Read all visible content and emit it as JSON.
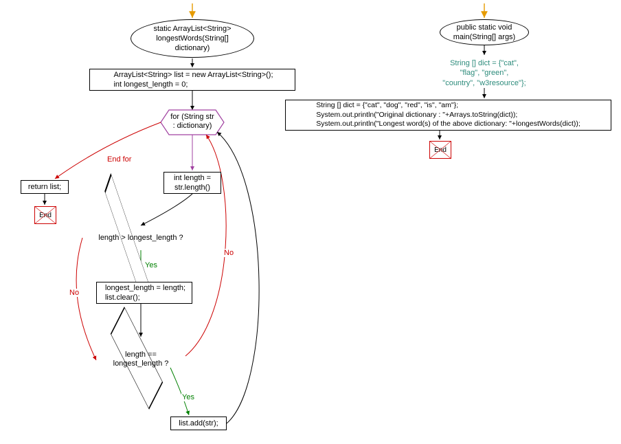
{
  "left": {
    "start": "static ArrayList<String>\nlongestWords(String[]\ndictionary)",
    "init": "ArrayList<String> list = new ArrayList<String>();\nint longest_length = 0;",
    "loop": "for (String str\n: dictionary)",
    "endfor_label": "End for",
    "return": "return list;",
    "end": "End",
    "lenAssign": "int length =\nstr.length()",
    "cond1": "length > longest_length ?",
    "yes": "Yes",
    "no": "No",
    "clear": "longest_length = length;\nlist.clear();",
    "cond2": "length ==\nlongest_length ?",
    "add": "list.add(str);"
  },
  "right": {
    "start": "public static void\nmain(String[] args)",
    "dictComment": "String [] dict = {\"cat\",\n\"flag\", \"green\",\n\"country\", \"w3resource\"};",
    "block": "String [] dict = {\"cat\", \"dog\", \"red\", \"is\", \"am\"};\nSystem.out.println(\"Original dictionary : \"+Arrays.toString(dict));\nSystem.out.println(\"Longest word(s) of the above dictionary: \"+longestWords(dict));",
    "end": "End"
  },
  "chart_data": {
    "type": "flowchart",
    "subgraphs": [
      {
        "name": "longestWords",
        "nodes": [
          {
            "id": "l_entry",
            "kind": "entry_arrow"
          },
          {
            "id": "l_start",
            "kind": "terminator",
            "text": "static ArrayList<String> longestWords(String[] dictionary)"
          },
          {
            "id": "l_init",
            "kind": "process",
            "text": "ArrayList<String> list = new ArrayList<String>(); int longest_length = 0;"
          },
          {
            "id": "l_loop",
            "kind": "loop_hex",
            "text": "for (String str : dictionary)"
          },
          {
            "id": "l_return",
            "kind": "process",
            "text": "return list;"
          },
          {
            "id": "l_end",
            "kind": "end"
          },
          {
            "id": "l_len",
            "kind": "process",
            "text": "int length = str.length()"
          },
          {
            "id": "l_cond1",
            "kind": "decision",
            "text": "length > longest_length ?"
          },
          {
            "id": "l_clear",
            "kind": "process",
            "text": "longest_length = length; list.clear();"
          },
          {
            "id": "l_cond2",
            "kind": "decision",
            "text": "length == longest_length ?"
          },
          {
            "id": "l_add",
            "kind": "process",
            "text": "list.add(str);"
          }
        ],
        "edges": [
          {
            "from": "l_entry",
            "to": "l_start",
            "color": "orange"
          },
          {
            "from": "l_start",
            "to": "l_init"
          },
          {
            "from": "l_init",
            "to": "l_loop"
          },
          {
            "from": "l_loop",
            "to": "l_return",
            "label": "End for",
            "color": "red"
          },
          {
            "from": "l_return",
            "to": "l_end"
          },
          {
            "from": "l_loop",
            "to": "l_len",
            "color": "purple"
          },
          {
            "from": "l_len",
            "to": "l_cond1"
          },
          {
            "from": "l_cond1",
            "to": "l_clear",
            "label": "Yes",
            "color": "green"
          },
          {
            "from": "l_cond1",
            "to": "l_cond2",
            "label": "No",
            "color": "red"
          },
          {
            "from": "l_clear",
            "to": "l_cond2"
          },
          {
            "from": "l_cond2",
            "to": "l_add",
            "label": "Yes",
            "color": "green"
          },
          {
            "from": "l_cond2",
            "to": "l_loop",
            "label": "No",
            "color": "red"
          },
          {
            "from": "l_add",
            "to": "l_loop"
          }
        ]
      },
      {
        "name": "main",
        "nodes": [
          {
            "id": "r_entry",
            "kind": "entry_arrow"
          },
          {
            "id": "r_start",
            "kind": "terminator",
            "text": "public static void main(String[] args)"
          },
          {
            "id": "r_comment",
            "kind": "comment",
            "text": "String [] dict = {\"cat\", \"flag\", \"green\", \"country\", \"w3resource\"};"
          },
          {
            "id": "r_block",
            "kind": "process",
            "text": "String [] dict = {\"cat\", \"dog\", \"red\", \"is\", \"am\"}; System.out.println(\"Original dictionary : \"+Arrays.toString(dict)); System.out.println(\"Longest word(s) of the above dictionary: \"+longestWords(dict));"
          },
          {
            "id": "r_end",
            "kind": "end"
          }
        ],
        "edges": [
          {
            "from": "r_entry",
            "to": "r_start",
            "color": "orange"
          },
          {
            "from": "r_start",
            "to": "r_comment"
          },
          {
            "from": "r_comment",
            "to": "r_block"
          },
          {
            "from": "r_block",
            "to": "r_end"
          }
        ]
      }
    ]
  }
}
